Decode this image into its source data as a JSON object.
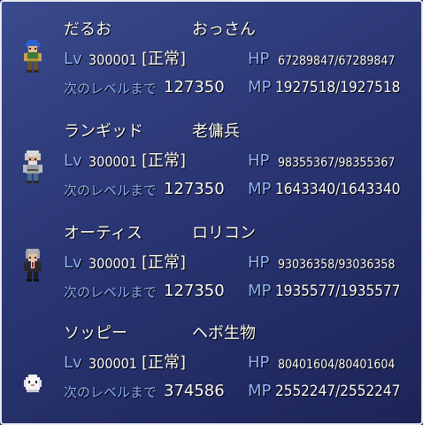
{
  "party": [
    {
      "name": "だるお",
      "class": "おっさん",
      "lv_label": "Lv",
      "level": "300001",
      "status": "[正常]",
      "hp_label": "HP",
      "hp": "67289847/67289847",
      "next_label": "次のレベルまで",
      "next_exp": "127350",
      "mp_label": "MP",
      "mp": "1927518/1927518",
      "sprite": "blue-haired-warrior-icon"
    },
    {
      "name": "ランギッド",
      "class": "老傭兵",
      "lv_label": "Lv",
      "level": "300001",
      "status": "[正常]",
      "hp_label": "HP",
      "hp": "98355367/98355367",
      "next_label": "次のレベルまで",
      "next_exp": "127350",
      "mp_label": "MP",
      "mp": "1643340/1643340",
      "sprite": "old-mercenary-icon"
    },
    {
      "name": "オーティス",
      "class": "ロリコン",
      "lv_label": "Lv",
      "level": "300001",
      "status": "[正常]",
      "hp_label": "HP",
      "hp": "93036358/93036358",
      "next_label": "次のレベルまで",
      "next_exp": "127350",
      "mp_label": "MP",
      "mp": "1935577/1935577",
      "sprite": "gray-haired-man-icon"
    },
    {
      "name": "ソッピー",
      "class": "ヘボ生物",
      "lv_label": "Lv",
      "level": "300001",
      "status": "[正常]",
      "hp_label": "HP",
      "hp": "80401604/80401604",
      "next_label": "次のレベルまで",
      "next_exp": "374586",
      "mp_label": "MP",
      "mp": "2552247/2552247",
      "sprite": "white-creature-icon"
    }
  ]
}
